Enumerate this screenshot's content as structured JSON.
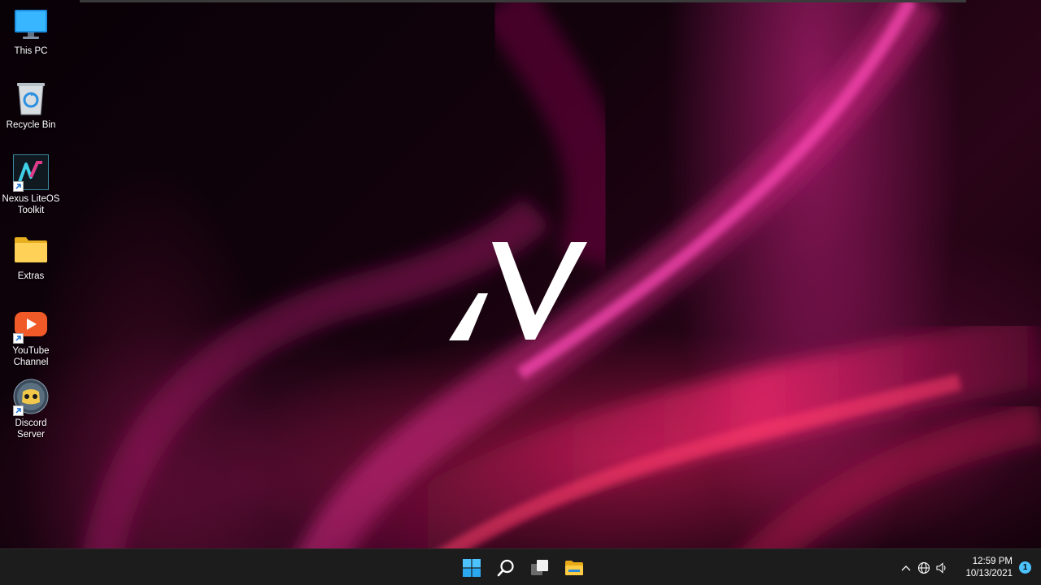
{
  "desktop": {
    "icons": [
      {
        "label": "This PC",
        "icon": "monitor-icon",
        "shortcut": false
      },
      {
        "label": "Recycle Bin",
        "icon": "recycle-bin-icon",
        "shortcut": false
      },
      {
        "label": "Nexus LiteOS\nToolkit",
        "icon": "nexus-toolkit-icon",
        "shortcut": true
      },
      {
        "label": "Extras",
        "icon": "folder-icon",
        "shortcut": false
      },
      {
        "label": "YouTube\nChannel",
        "icon": "youtube-icon",
        "shortcut": true
      },
      {
        "label": "Discord\nServer",
        "icon": "discord-icon",
        "shortcut": true
      }
    ]
  },
  "taskbar": {
    "pinned": [
      {
        "name": "start-button",
        "icon": "windows-logo-icon"
      },
      {
        "name": "search-button",
        "icon": "search-icon"
      },
      {
        "name": "task-view-button",
        "icon": "task-view-icon"
      },
      {
        "name": "file-explorer-button",
        "icon": "file-explorer-icon"
      }
    ],
    "tray": {
      "time": "12:59 PM",
      "date": "10/13/2021",
      "notification_count": "1",
      "icons": [
        "chevron-up-icon",
        "network-globe-icon",
        "speaker-icon"
      ]
    }
  },
  "colors": {
    "taskbar_bg": "#1c1c1c",
    "accent_blue": "#4cc2ff",
    "wallpaper_pink": "#e0288f"
  }
}
